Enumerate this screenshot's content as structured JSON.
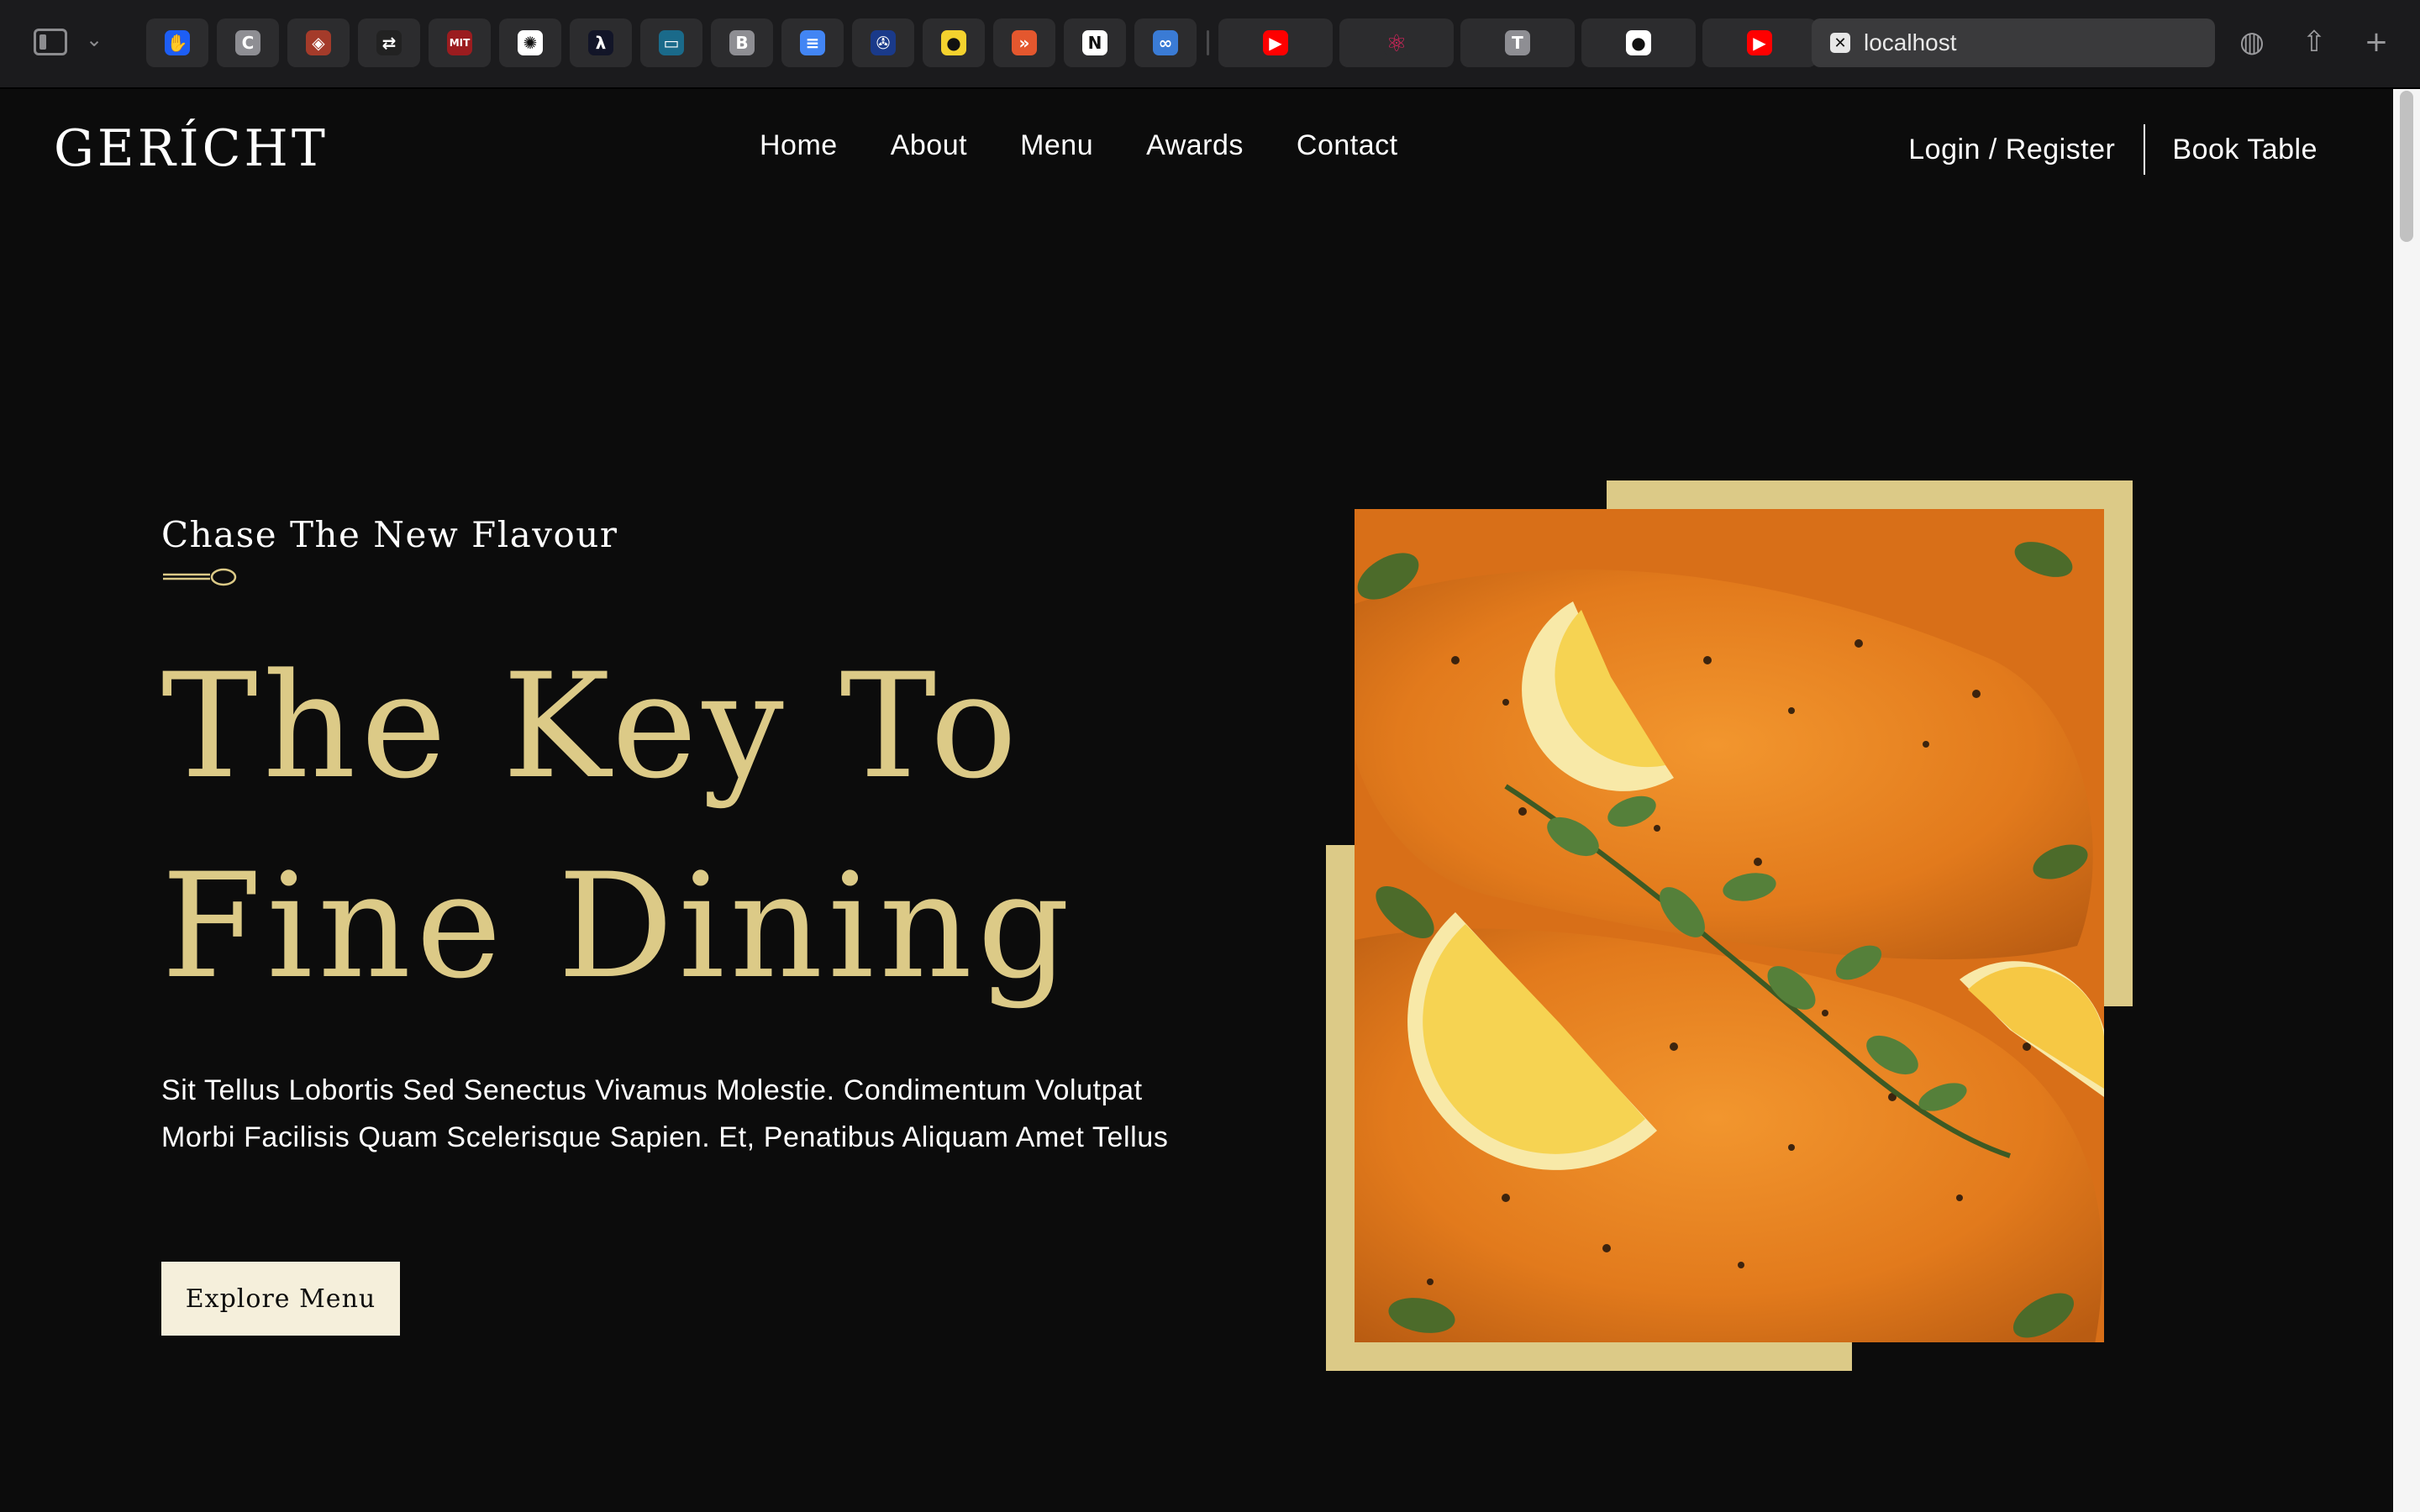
{
  "browser": {
    "url": "localhost",
    "tabs": [
      {
        "icon": "shield-hand-icon",
        "glyph": "✋",
        "bg": "#1d5ef5"
      },
      {
        "icon": "c-app-icon",
        "glyph": "C",
        "bg": "#8e8e93"
      },
      {
        "icon": "pattern-app-icon",
        "glyph": "◈",
        "bg": "#a43b2a"
      },
      {
        "icon": "swap-app-icon",
        "glyph": "⇄",
        "bg": "#222222"
      },
      {
        "icon": "mit-ocw-icon",
        "glyph": "MIT",
        "bg": "#9b1c1f"
      },
      {
        "icon": "openai-icon",
        "glyph": "✺",
        "bg": "#ffffff"
      },
      {
        "icon": "code-lambda-icon",
        "glyph": "λ",
        "bg": "#121528"
      },
      {
        "icon": "dots-app-icon",
        "glyph": "▭",
        "bg": "#1a6a8a"
      },
      {
        "icon": "b-app-icon",
        "glyph": "B",
        "bg": "#8e8e93"
      },
      {
        "icon": "docs-icon",
        "glyph": "≡",
        "bg": "#4285f4"
      },
      {
        "icon": "film-reel-icon",
        "glyph": "✇",
        "bg": "#1a3a8a"
      },
      {
        "icon": "otta-icon",
        "glyph": "●",
        "bg": "#f4d22e"
      },
      {
        "icon": "chevron-app-icon",
        "glyph": "»",
        "bg": "#e4572e"
      },
      {
        "icon": "notion-icon",
        "glyph": "N",
        "bg": "#ffffff"
      },
      {
        "icon": "link-app-icon",
        "glyph": "∞",
        "bg": "#3a7bd5"
      }
    ],
    "wide_tabs": [
      {
        "icon": "youtube-icon",
        "glyph": "▶",
        "bg": "#ff0000"
      },
      {
        "icon": "react-icon",
        "glyph": "⚛",
        "bg": "#2c2c2e"
      },
      {
        "icon": "t-app-icon",
        "glyph": "T",
        "bg": "#8e8e93"
      },
      {
        "icon": "github-icon",
        "glyph": "●",
        "bg": "#ffffff"
      },
      {
        "icon": "youtube-icon",
        "glyph": "▶",
        "bg": "#ff0000"
      }
    ]
  },
  "site": {
    "logo": "GERÍCHT",
    "nav": [
      "Home",
      "About",
      "Menu",
      "Awards",
      "Contact"
    ],
    "login": "Login / Register",
    "book": "Book Table"
  },
  "hero": {
    "subtitle": "Chase The New Flavour",
    "headline_line1": "The Key To",
    "headline_line2": "Fine Dining",
    "description": "Sit Tellus Lobortis Sed Senectus Vivamus Molestie. Condimentum Volutpat Morbi Facilisis Quam Scelerisque Sapien. Et, Penatibus Aliquam Amet Tellus",
    "cta": "Explore Menu"
  },
  "colors": {
    "background": "#0c0c0c",
    "golden": "#dcca87",
    "cta_bg": "#f5efdb"
  }
}
